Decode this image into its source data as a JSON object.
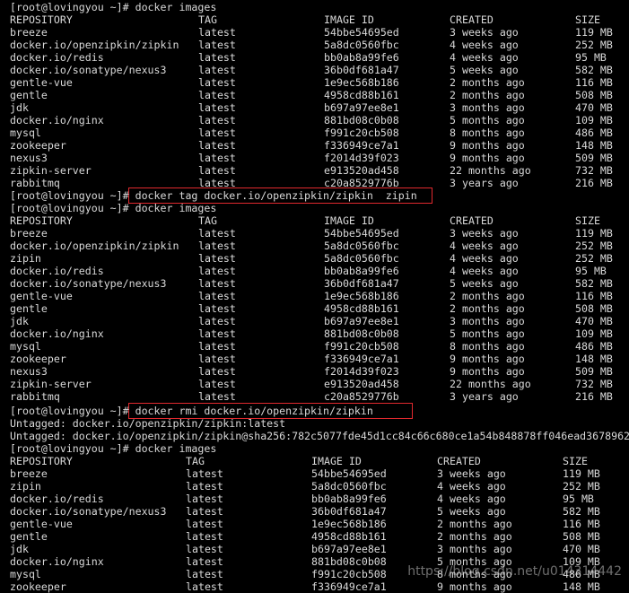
{
  "blocks": [
    {
      "prompt": "[root@lovingyou ~]# docker images",
      "headers": [
        "REPOSITORY",
        "TAG",
        "IMAGE ID",
        "CREATED",
        "SIZE"
      ],
      "rows": [
        [
          "breeze",
          "latest",
          "54bbe54695ed",
          "3 weeks ago",
          "119 MB"
        ],
        [
          "docker.io/openzipkin/zipkin",
          "latest",
          "5a8dc0560fbc",
          "4 weeks ago",
          "252 MB"
        ],
        [
          "docker.io/redis",
          "latest",
          "bb0ab8a99fe6",
          "4 weeks ago",
          "95 MB"
        ],
        [
          "docker.io/sonatype/nexus3",
          "latest",
          "36b0df681a47",
          "5 weeks ago",
          "582 MB"
        ],
        [
          "gentle-vue",
          "latest",
          "1e9ec568b186",
          "2 months ago",
          "116 MB"
        ],
        [
          "gentle",
          "latest",
          "4958cd88b161",
          "2 months ago",
          "508 MB"
        ],
        [
          "jdk",
          "latest",
          "b697a97ee8e1",
          "3 months ago",
          "470 MB"
        ],
        [
          "docker.io/nginx",
          "latest",
          "881bd08c0b08",
          "5 months ago",
          "109 MB"
        ],
        [
          "mysql",
          "latest",
          "f991c20cb508",
          "8 months ago",
          "486 MB"
        ],
        [
          "zookeeper",
          "latest",
          "f336949ce7a1",
          "9 months ago",
          "148 MB"
        ],
        [
          "nexus3",
          "latest",
          "f2014d39f023",
          "9 months ago",
          "509 MB"
        ],
        [
          "zipkin-server",
          "latest",
          "e913520ad458",
          "22 months ago",
          "732 MB"
        ],
        [
          "rabbitmq",
          "latest",
          "c20a8529776b",
          "3 years ago",
          "216 MB"
        ]
      ]
    },
    {
      "prompt": "[root@lovingyou ~]# docker tag docker.io/openzipkin/zipkin  zipin"
    },
    {
      "prompt": "[root@lovingyou ~]# docker images",
      "headers": [
        "REPOSITORY",
        "TAG",
        "IMAGE ID",
        "CREATED",
        "SIZE"
      ],
      "rows": [
        [
          "breeze",
          "latest",
          "54bbe54695ed",
          "3 weeks ago",
          "119 MB"
        ],
        [
          "docker.io/openzipkin/zipkin",
          "latest",
          "5a8dc0560fbc",
          "4 weeks ago",
          "252 MB"
        ],
        [
          "zipin",
          "latest",
          "5a8dc0560fbc",
          "4 weeks ago",
          "252 MB"
        ],
        [
          "docker.io/redis",
          "latest",
          "bb0ab8a99fe6",
          "4 weeks ago",
          "95 MB"
        ],
        [
          "docker.io/sonatype/nexus3",
          "latest",
          "36b0df681a47",
          "5 weeks ago",
          "582 MB"
        ],
        [
          "gentle-vue",
          "latest",
          "1e9ec568b186",
          "2 months ago",
          "116 MB"
        ],
        [
          "gentle",
          "latest",
          "4958cd88b161",
          "2 months ago",
          "508 MB"
        ],
        [
          "jdk",
          "latest",
          "b697a97ee8e1",
          "3 months ago",
          "470 MB"
        ],
        [
          "docker.io/nginx",
          "latest",
          "881bd08c0b08",
          "5 months ago",
          "109 MB"
        ],
        [
          "mysql",
          "latest",
          "f991c20cb508",
          "8 months ago",
          "486 MB"
        ],
        [
          "zookeeper",
          "latest",
          "f336949ce7a1",
          "9 months ago",
          "148 MB"
        ],
        [
          "nexus3",
          "latest",
          "f2014d39f023",
          "9 months ago",
          "509 MB"
        ],
        [
          "zipkin-server",
          "latest",
          "e913520ad458",
          "22 months ago",
          "732 MB"
        ],
        [
          "rabbitmq",
          "latest",
          "c20a8529776b",
          "3 years ago",
          "216 MB"
        ]
      ]
    },
    {
      "prompt": "[root@lovingyou ~]# docker rmi docker.io/openzipkin/zipkin",
      "output": [
        "Untagged: docker.io/openzipkin/zipkin:latest",
        "Untagged: docker.io/openzipkin/zipkin@sha256:782c5077fde45d1cc84c66c680ce1a54b848878ff046ead3678962"
      ]
    },
    {
      "prompt": "[root@lovingyou ~]# docker images",
      "headers": [
        "REPOSITORY",
        "TAG",
        "IMAGE ID",
        "CREATED",
        "SIZE"
      ],
      "rows": [
        [
          "breeze",
          "latest",
          "54bbe54695ed",
          "3 weeks ago",
          "119 MB"
        ],
        [
          "zipin",
          "latest",
          "5a8dc0560fbc",
          "4 weeks ago",
          "252 MB"
        ],
        [
          "docker.io/redis",
          "latest",
          "bb0ab8a99fe6",
          "4 weeks ago",
          "95 MB"
        ],
        [
          "docker.io/sonatype/nexus3",
          "latest",
          "36b0df681a47",
          "5 weeks ago",
          "582 MB"
        ],
        [
          "gentle-vue",
          "latest",
          "1e9ec568b186",
          "2 months ago",
          "116 MB"
        ],
        [
          "gentle",
          "latest",
          "4958cd88b161",
          "2 months ago",
          "508 MB"
        ],
        [
          "jdk",
          "latest",
          "b697a97ee8e1",
          "3 months ago",
          "470 MB"
        ],
        [
          "docker.io/nginx",
          "latest",
          "881bd08c0b08",
          "5 months ago",
          "109 MB"
        ],
        [
          "mysql",
          "latest",
          "f991c20cb508",
          "8 months ago",
          "486 MB"
        ],
        [
          "zookeeper",
          "latest",
          "f336949ce7a1",
          "9 months ago",
          "148 MB"
        ]
      ]
    }
  ],
  "watermark": "https://blog.csdn.net/u014314442",
  "colors": {
    "background": "#000000",
    "text": "#d9d9d9",
    "highlight": "#e0292e"
  }
}
